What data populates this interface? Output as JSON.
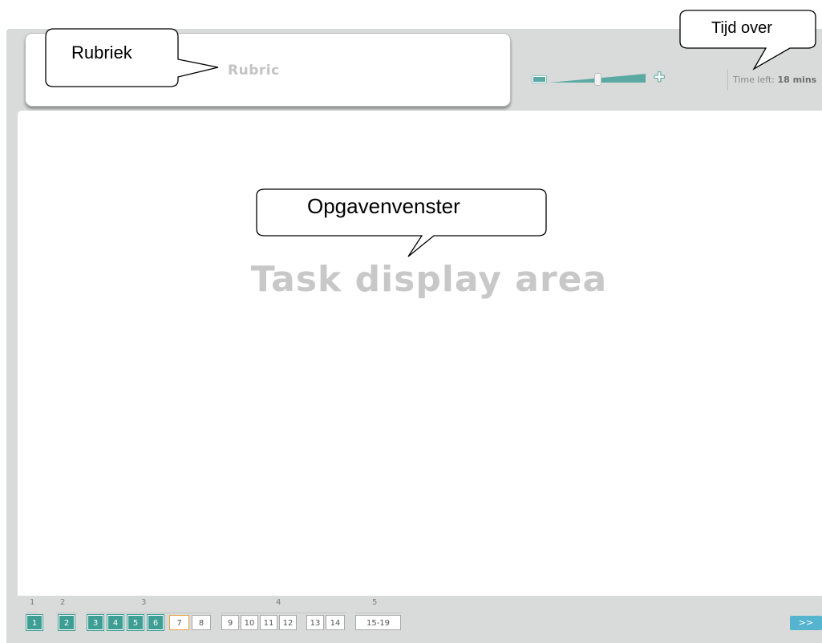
{
  "header": {
    "rubric_label": "Rubric",
    "time_left_label": "Time left:",
    "time_left_value": "18 mins"
  },
  "zoom": {
    "level_fraction": 0.55
  },
  "task": {
    "placeholder": "Task display area"
  },
  "callouts": {
    "rubriek": "Rubriek",
    "tijd_over": "Tijd over",
    "opgavenvenster": "Opgavenvenster"
  },
  "navigation": {
    "sections": [
      "1",
      "2",
      "3",
      "4",
      "5"
    ],
    "questions": [
      {
        "label": "1",
        "state": "done"
      },
      {
        "label": "2",
        "state": "done"
      },
      {
        "label": "3",
        "state": "done"
      },
      {
        "label": "4",
        "state": "done"
      },
      {
        "label": "5",
        "state": "done"
      },
      {
        "label": "6",
        "state": "done"
      },
      {
        "label": "7",
        "state": "current"
      },
      {
        "label": "8",
        "state": "todo"
      },
      {
        "label": "9",
        "state": "todo"
      },
      {
        "label": "10",
        "state": "todo"
      },
      {
        "label": "11",
        "state": "todo"
      },
      {
        "label": "12",
        "state": "todo"
      },
      {
        "label": "13",
        "state": "todo"
      },
      {
        "label": "14",
        "state": "todo"
      },
      {
        "label": "15-19",
        "state": "todo"
      }
    ],
    "next_label": ">>"
  },
  "colors": {
    "done": "#3e9e94",
    "current_border": "#e8a33d",
    "accent": "#55b5d0",
    "frame": "#d9dada"
  }
}
